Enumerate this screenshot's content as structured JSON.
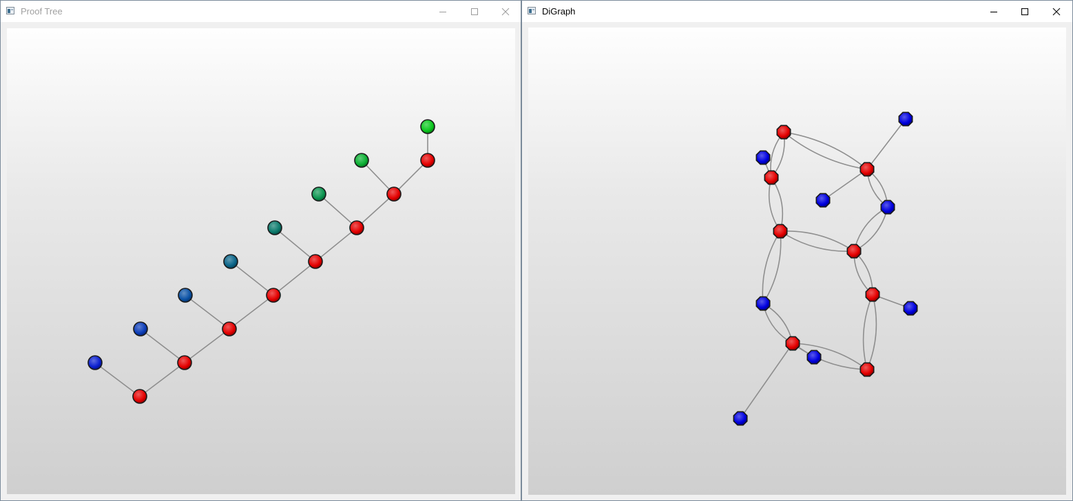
{
  "windows": {
    "proof_tree": {
      "title": "Proof Tree",
      "controls": {
        "minimize_icon": "minimize-icon",
        "maximize_icon": "maximize-icon",
        "close_icon": "close-icon"
      },
      "node_shape": "circle",
      "edge_color": "#8e8e8e",
      "nodes": [
        {
          "id": "r1",
          "color": "#e50000"
        },
        {
          "id": "r2",
          "color": "#e50000"
        },
        {
          "id": "r3",
          "color": "#e50000"
        },
        {
          "id": "r4",
          "color": "#e50000"
        },
        {
          "id": "r5",
          "color": "#e50000"
        },
        {
          "id": "r6",
          "color": "#e50000"
        },
        {
          "id": "r7",
          "color": "#e50000"
        },
        {
          "id": "r8",
          "color": "#e50000"
        },
        {
          "id": "l1",
          "color": "#0a1fd0"
        },
        {
          "id": "l2",
          "color": "#0b3cb8"
        },
        {
          "id": "l3",
          "color": "#0b52a6"
        },
        {
          "id": "l4",
          "color": "#0b6589"
        },
        {
          "id": "l5",
          "color": "#0b7a6c"
        },
        {
          "id": "l6",
          "color": "#0b9550"
        },
        {
          "id": "l7",
          "color": "#0bb033"
        },
        {
          "id": "l8",
          "color": "#0bc81e"
        }
      ],
      "edges": [
        [
          "r1",
          "r2"
        ],
        [
          "r2",
          "r3"
        ],
        [
          "r3",
          "r4"
        ],
        [
          "r4",
          "r5"
        ],
        [
          "r5",
          "r6"
        ],
        [
          "r6",
          "r7"
        ],
        [
          "r7",
          "r8"
        ],
        [
          "r1",
          "l1"
        ],
        [
          "r2",
          "l2"
        ],
        [
          "r3",
          "l3"
        ],
        [
          "r4",
          "l4"
        ],
        [
          "r5",
          "l5"
        ],
        [
          "r6",
          "l6"
        ],
        [
          "r7",
          "l7"
        ],
        [
          "r8",
          "l8"
        ]
      ]
    },
    "digraph": {
      "title": "DiGraph",
      "controls": {
        "minimize_icon": "minimize-icon",
        "maximize_icon": "maximize-icon",
        "close_icon": "close-icon"
      },
      "node_shape": "octagon",
      "edge_color": "#8e8e8e",
      "nodes": [
        {
          "id": "A",
          "color": "#e50000"
        },
        {
          "id": "B",
          "color": "#e50000"
        },
        {
          "id": "C",
          "color": "#e50000"
        },
        {
          "id": "D",
          "color": "#e50000"
        },
        {
          "id": "E",
          "color": "#e50000"
        },
        {
          "id": "F",
          "color": "#e50000"
        },
        {
          "id": "G",
          "color": "#e50000"
        },
        {
          "id": "H",
          "color": "#e50000"
        },
        {
          "id": "b1",
          "color": "#0000e0"
        },
        {
          "id": "b2",
          "color": "#0000e0"
        },
        {
          "id": "b3",
          "color": "#0000e0"
        },
        {
          "id": "b4",
          "color": "#0000e0"
        },
        {
          "id": "b5",
          "color": "#0000e0"
        },
        {
          "id": "b6",
          "color": "#0000e0"
        },
        {
          "id": "b7",
          "color": "#0000e0"
        },
        {
          "id": "b8",
          "color": "#0000e0"
        }
      ],
      "edges": [
        {
          "from": "A",
          "to": "C",
          "curve": "double"
        },
        {
          "from": "A",
          "to": "B",
          "curve": "double"
        },
        {
          "from": "C",
          "to": "D",
          "curve": "double"
        },
        {
          "from": "D",
          "to": "E",
          "curve": "double"
        },
        {
          "from": "B",
          "to": "b4",
          "curve": "double"
        },
        {
          "from": "b4",
          "to": "E",
          "curve": "double"
        },
        {
          "from": "E",
          "to": "F",
          "curve": "double"
        },
        {
          "from": "D",
          "to": "b5",
          "curve": "double"
        },
        {
          "from": "b5",
          "to": "G",
          "curve": "double"
        },
        {
          "from": "G",
          "to": "H",
          "curve": "double"
        },
        {
          "from": "F",
          "to": "H",
          "curve": "double"
        },
        {
          "from": "B",
          "to": "b2",
          "curve": "straight"
        },
        {
          "from": "B",
          "to": "b3",
          "curve": "straight"
        },
        {
          "from": "C",
          "to": "b1",
          "curve": "straight"
        },
        {
          "from": "F",
          "to": "b6",
          "curve": "straight"
        },
        {
          "from": "G",
          "to": "b7",
          "curve": "straight"
        },
        {
          "from": "G",
          "to": "b8",
          "curve": "straight"
        }
      ]
    }
  }
}
